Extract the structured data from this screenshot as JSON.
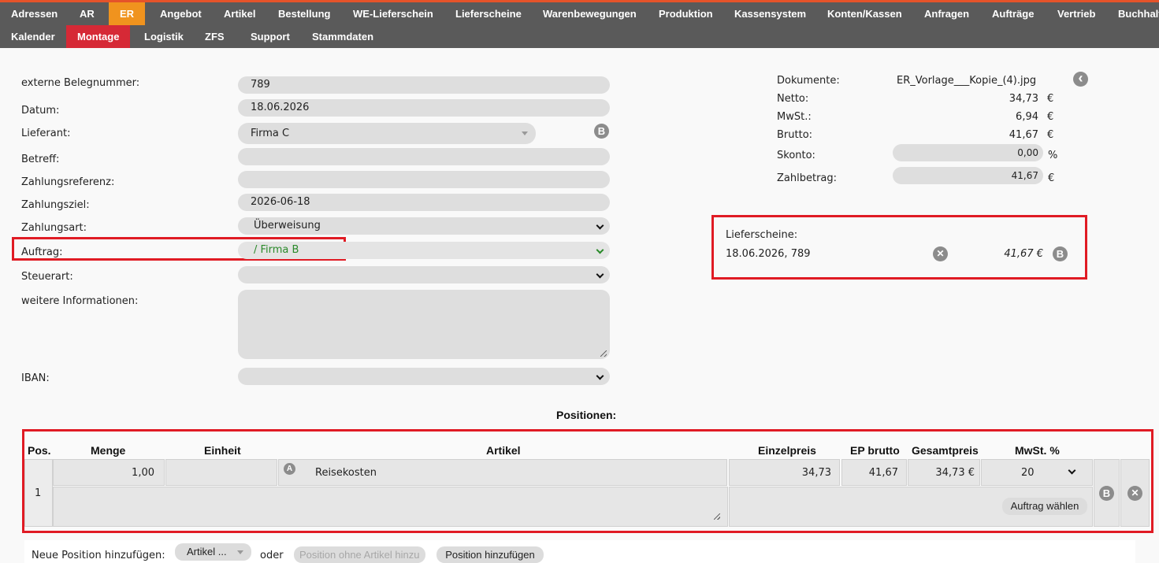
{
  "nav": {
    "row1": [
      "Adressen",
      "AR",
      "ER",
      "Angebot",
      "Artikel",
      "Bestellung",
      "WE-Lieferschein",
      "Lieferscheine",
      "Warenbewegungen",
      "Produktion",
      "Kassensystem",
      "Konten/Kassen",
      "Anfragen",
      "Aufträge",
      "Vertrieb",
      "Buchhalt"
    ],
    "row2": [
      "Kalender",
      "Montage",
      "Logistik",
      "ZFS",
      "Support",
      "Stammdaten"
    ]
  },
  "form": {
    "ext_beleg_label": "externe Belegnummer:",
    "ext_beleg_value": "789",
    "datum_label": "Datum:",
    "datum_value": "18.06.2026",
    "lieferant_label": "Lieferant:",
    "lieferant_value": "Firma C",
    "betreff_label": "Betreff:",
    "zahlungsreferenz_label": "Zahlungsreferenz:",
    "zahlungsziel_label": "Zahlungsziel:",
    "zahlungsziel_value": "2026-06-18",
    "zahlungsart_label": "Zahlungsart:",
    "zahlungsart_value": "Überweisung",
    "auftrag_label": "Auftrag:",
    "auftrag_value": "/ Firma B",
    "steuerart_label": "Steuerart:",
    "weitere_label": "weitere Informationen:",
    "iban_label": "IBAN:"
  },
  "summary": {
    "dokumente_label": "Dokumente:",
    "dokumente_value": "ER_Vorlage___Kopie_(4).jpg",
    "netto_label": "Netto:",
    "netto_value": "34,73",
    "mwst_label": "MwSt.:",
    "mwst_value": "6,94",
    "brutto_label": "Brutto:",
    "brutto_value": "41,67",
    "skonto_label": "Skonto:",
    "skonto_value": "0,00",
    "skonto_unit": "%",
    "zahlbetrag_label": "Zahlbetrag:",
    "zahlbetrag_value": "41,67",
    "currency": "€"
  },
  "lieferscheine": {
    "label": "Lieferscheine:",
    "entry": "18.06.2026, 789",
    "amount": "41,67 €"
  },
  "positions": {
    "title": "Positionen:",
    "headers": {
      "pos": "Pos.",
      "menge": "Menge",
      "einheit": "Einheit",
      "artikel": "Artikel",
      "einzelpreis": "Einzelpreis",
      "ep_brutto": "EP brutto",
      "gesamtpreis": "Gesamtpreis",
      "mwst": "MwSt. %"
    },
    "row": {
      "pos": "1",
      "menge": "1,00",
      "einheit": "",
      "artikel": "Reisekosten",
      "einzelpreis": "34,73",
      "ep_brutto": "41,67",
      "gesamtpreis": "34,73 €",
      "mwst": "20",
      "auftrag_btn": "Auftrag wählen"
    }
  },
  "add_position": {
    "label": "Neue Position hinzufügen:",
    "artikel_select": "Artikel ...",
    "oder": "oder",
    "placeholder": "Position ohne Artikel hinzu",
    "button": "Position hinzufügen"
  },
  "icons": {
    "b_letter": "B",
    "a_letter": "A",
    "x_glyph": "✕",
    "back_glyph": "‹"
  },
  "colors": {
    "nav_bg": "#5a5a5a",
    "active_er": "#f0931e",
    "active_montage": "#d62936",
    "accent": "#e5532a",
    "highlight_red": "#e01b24",
    "auftrag_green": "#2a8a2a"
  }
}
